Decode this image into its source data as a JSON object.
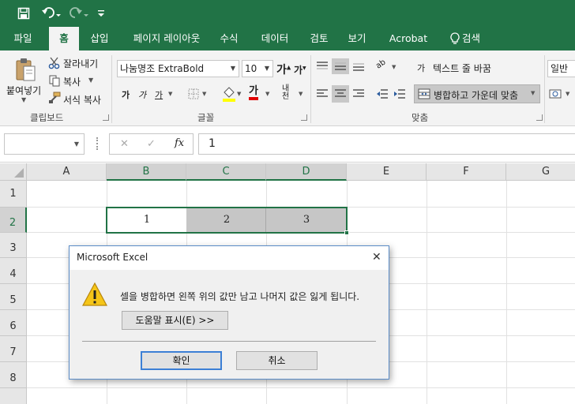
{
  "quick_access": {
    "save_icon": "save-icon",
    "undo_icon": "undo-icon",
    "redo_icon": "redo-icon",
    "customize_icon": "customize-icon"
  },
  "tabs": [
    {
      "label": "파일"
    },
    {
      "label": "홈",
      "active": true
    },
    {
      "label": "삽입"
    },
    {
      "label": "페이지 레이아웃"
    },
    {
      "label": "수식"
    },
    {
      "label": "데이터"
    },
    {
      "label": "검토"
    },
    {
      "label": "보기"
    },
    {
      "label": "Acrobat"
    },
    {
      "label": "검색"
    }
  ],
  "ribbon": {
    "clipboard": {
      "paste": "붙여넣기",
      "cut": "잘라내기",
      "copy": "복사",
      "format_painter": "서식 복사",
      "group_label": "클립보드"
    },
    "font": {
      "font_name": "나눔명조 ExtraBold",
      "font_size": "10",
      "grow": "가",
      "shrink": "가",
      "bold": "가",
      "italic": "가",
      "underline": "가",
      "font_color_glyph": "가",
      "phonetic": "내천",
      "group_label": "글꼴"
    },
    "alignment": {
      "wrap_text": "텍스트 줄 바꿈",
      "merge_center": "병합하고 가운데 맞춤",
      "orientation_glyph": "ab",
      "wrap_glyph": "가",
      "group_label": "맞춤"
    },
    "number": {
      "format": "일반"
    }
  },
  "formula_bar": {
    "name_box": "",
    "cancel": "✕",
    "enter": "✓",
    "fx": "fx",
    "value": "1"
  },
  "sheet": {
    "columns": [
      "A",
      "B",
      "C",
      "D",
      "E",
      "F",
      "G"
    ],
    "rows": [
      "1",
      "2",
      "3",
      "4",
      "5",
      "6",
      "7",
      "8"
    ],
    "cells": {
      "B2": "1",
      "C2": "2",
      "D2": "3"
    }
  },
  "dialog": {
    "title": "Microsoft Excel",
    "message": "셀을 병합하면 왼쪽 위의 값만 남고 나머지 값은 잃게 됩니다.",
    "help_button": "도움말 표시(E) >>",
    "ok_button": "확인",
    "cancel_button": "취소",
    "warning_icon": "warning-icon",
    "close_glyph": "✕"
  },
  "colors": {
    "brand": "#217346",
    "warning": "#f5c518",
    "selection": "#217346"
  }
}
